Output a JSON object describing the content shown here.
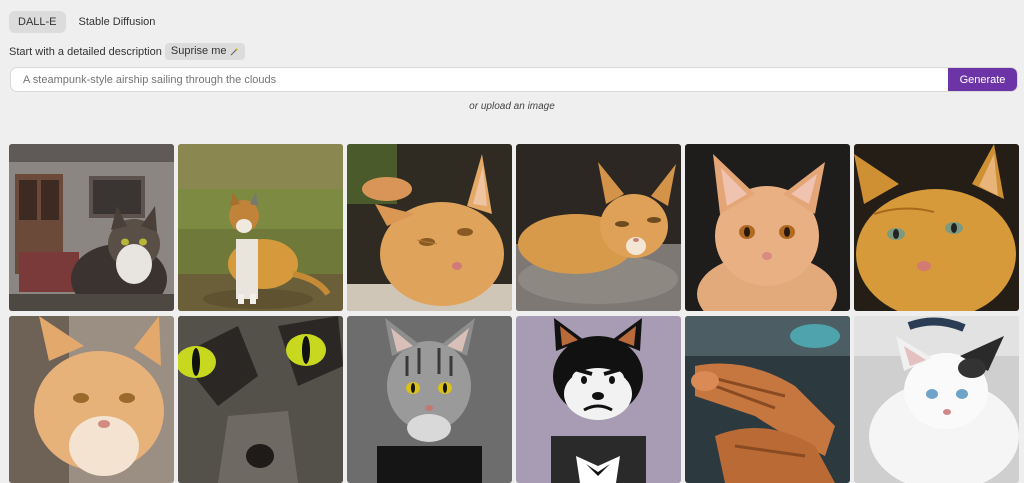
{
  "tabs": [
    {
      "label": "DALL-E",
      "active": true
    },
    {
      "label": "Stable Diffusion",
      "active": false
    }
  ],
  "description": {
    "label": "Start with a detailed description",
    "surprise_label": "Suprise me",
    "surprise_icon": "magic-wand-icon"
  },
  "prompt": {
    "placeholder": "A steampunk-style airship sailing through the clouds",
    "button_label": "Generate"
  },
  "upload": {
    "prefix": "or",
    "link": "upload an image"
  },
  "colors": {
    "accent": "#6d34a8",
    "background": "#efefef"
  },
  "gallery": [
    {
      "name": "gallery-image-tabby-house"
    },
    {
      "name": "gallery-image-calico-field"
    },
    {
      "name": "gallery-image-orange-closeup"
    },
    {
      "name": "gallery-image-orange-lying"
    },
    {
      "name": "gallery-image-orange-kitten"
    },
    {
      "name": "gallery-image-orange-portrait"
    },
    {
      "name": "gallery-image-orange-white"
    },
    {
      "name": "gallery-image-green-eyes"
    },
    {
      "name": "gallery-image-silver-tabby"
    },
    {
      "name": "gallery-image-cartoon-cat"
    },
    {
      "name": "gallery-image-ginger-paws"
    },
    {
      "name": "gallery-image-white-cat"
    }
  ]
}
